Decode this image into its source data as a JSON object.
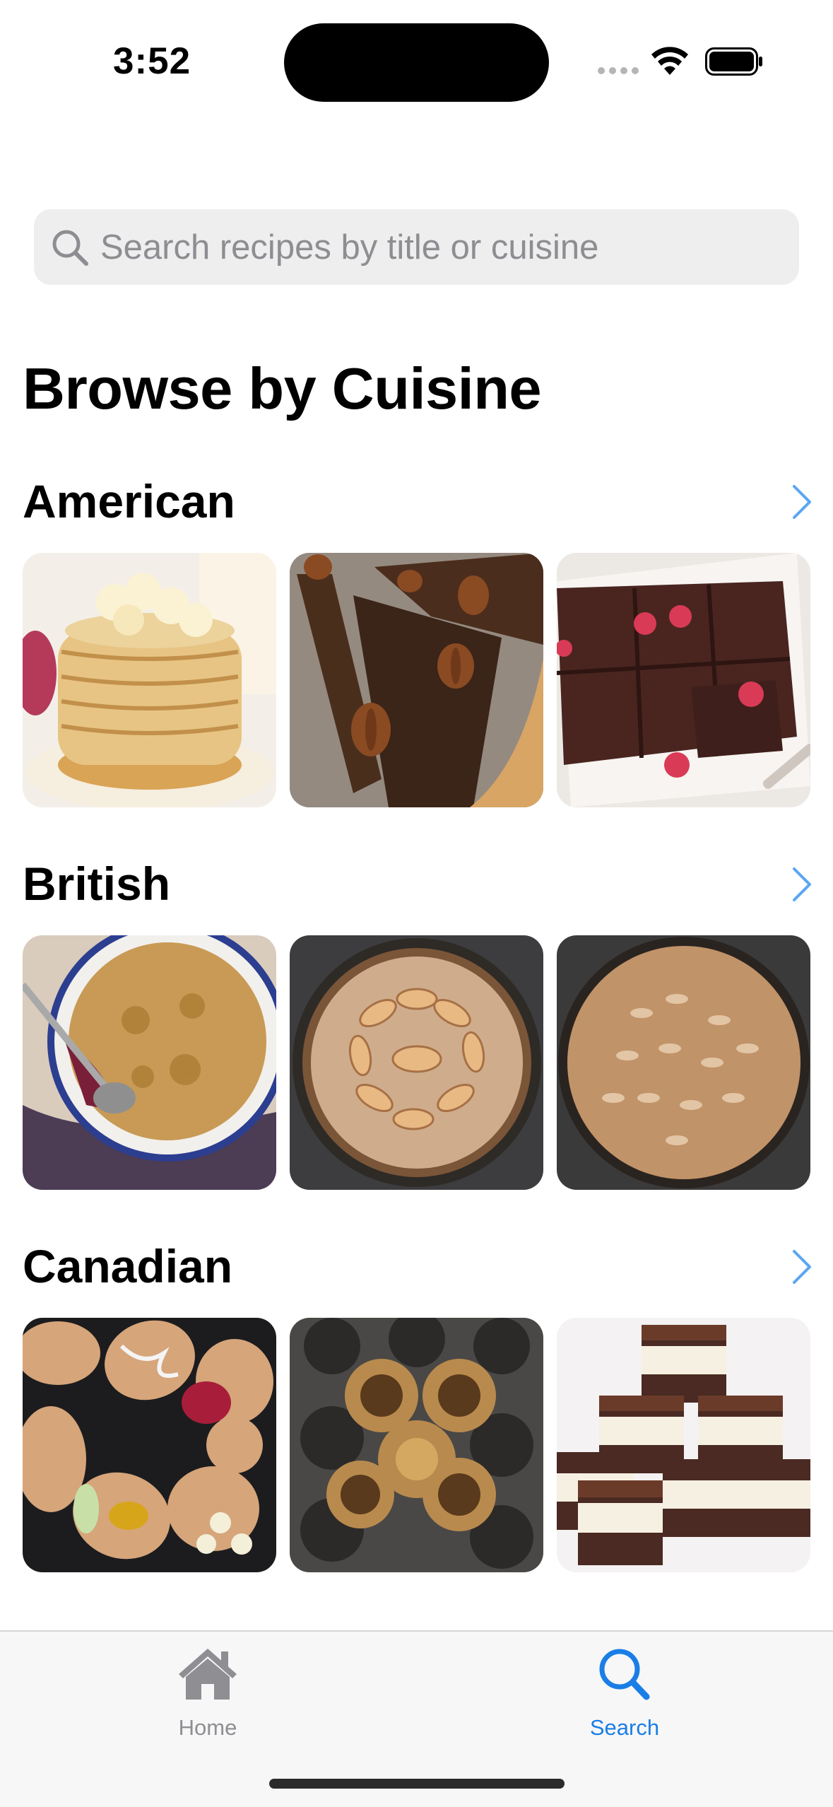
{
  "status_bar": {
    "time": "3:52"
  },
  "search": {
    "placeholder": "Search recipes by title or cuisine"
  },
  "page_title": "Browse by Cuisine",
  "sections": [
    {
      "title": "American",
      "images": [
        "banana-pancake-stack-photo",
        "pecan-pie-photo",
        "chocolate-brownies-raspberries-photo"
      ]
    },
    {
      "title": "British",
      "images": [
        "fruit-crumble-dish-photo",
        "apple-tart-photo",
        "almond-tart-photo"
      ]
    },
    {
      "title": "Canadian",
      "images": [
        "beavertails-pastries-photo",
        "butter-tarts-photo",
        "nanaimo-bars-photo"
      ]
    }
  ],
  "tab_bar": {
    "tabs": [
      {
        "label": "Home",
        "icon": "house-icon",
        "selected": false
      },
      {
        "label": "Search",
        "icon": "magnifier-icon",
        "selected": true
      }
    ]
  },
  "colors": {
    "accent": "#1a7ee6",
    "inactive": "#8e8e93",
    "chevron": "#5aa6f2"
  }
}
